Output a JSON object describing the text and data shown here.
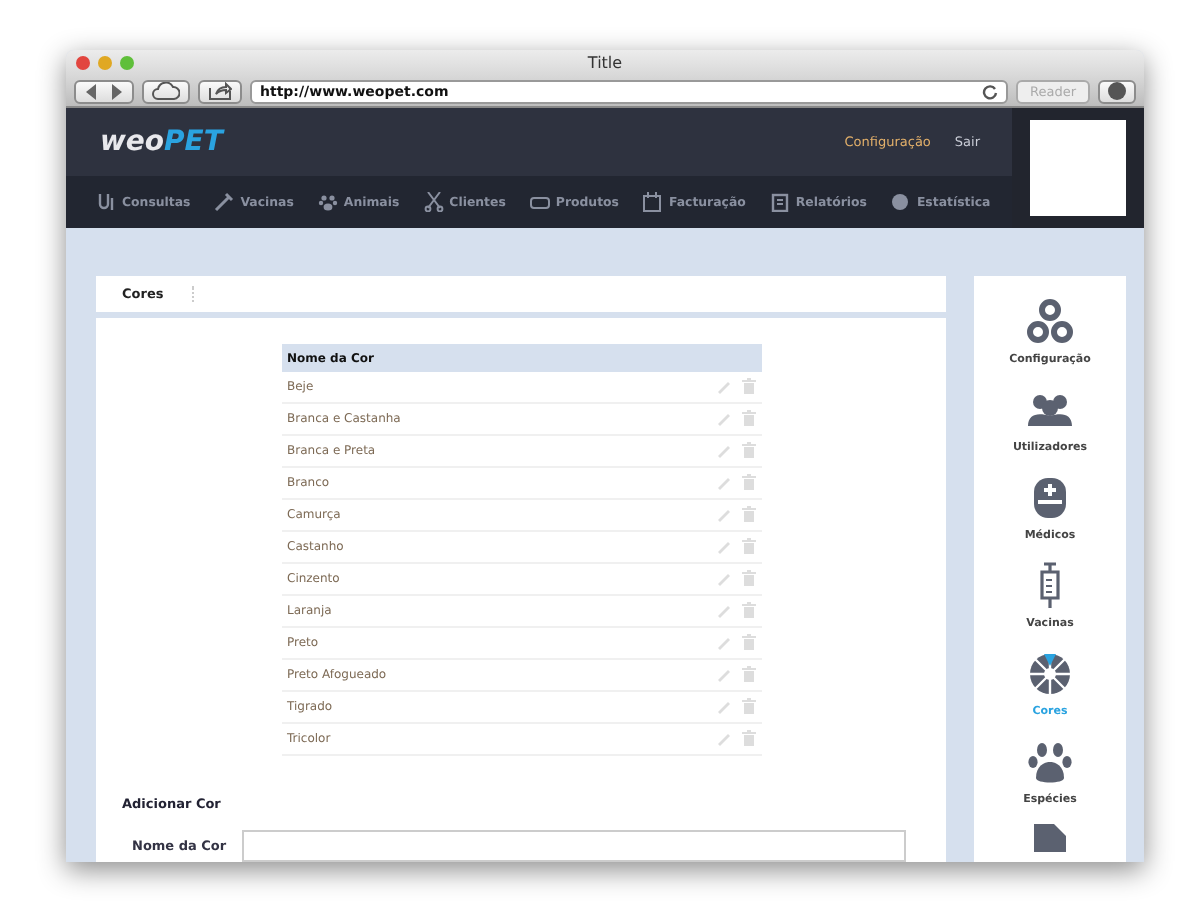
{
  "window": {
    "title": "Title"
  },
  "browser": {
    "url": "http://www.weopet.com",
    "reader": "Reader"
  },
  "header": {
    "logo_a": "weo",
    "logo_b": "PET",
    "links": [
      "Configuração",
      "Sair"
    ]
  },
  "nav": [
    "Consultas",
    "Vacinas",
    "Animais",
    "Clientes",
    "Produtos",
    "Facturação",
    "Relatórios",
    "Estatística"
  ],
  "panel": {
    "tab": "Cores",
    "column": "Nome da Cor",
    "rows": [
      "Beje",
      "Branca e Castanha",
      "Branca e Preta",
      "Branco",
      "Camurça",
      "Castanho",
      "Cinzento",
      "Laranja",
      "Preto",
      "Preto Afogueado",
      "Tigrado",
      "Tricolor"
    ]
  },
  "form": {
    "title": "Adicionar Cor",
    "field_label": "Nome da Cor"
  },
  "sidebar": [
    {
      "label": "Configuração",
      "selected": false
    },
    {
      "label": "Utilizadores",
      "selected": false
    },
    {
      "label": "Médicos",
      "selected": false
    },
    {
      "label": "Vacinas",
      "selected": false
    },
    {
      "label": "Cores",
      "selected": true
    },
    {
      "label": "Espécies",
      "selected": false
    }
  ]
}
